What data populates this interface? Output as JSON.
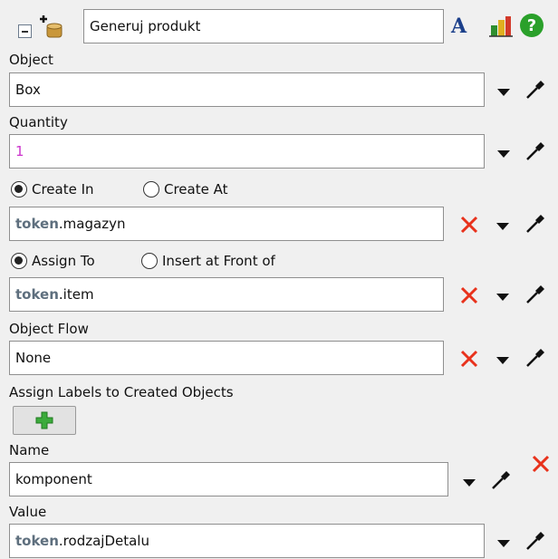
{
  "header": {
    "title": "Generuj produkt",
    "icons": [
      "collapse-icon",
      "add-object-icon",
      "font-icon",
      "color-chart-icon",
      "help-icon"
    ],
    "font_glyph": "A",
    "help_glyph": "?"
  },
  "object": {
    "label": "Object",
    "value": "Box"
  },
  "quantity": {
    "label": "Quantity",
    "value": "1"
  },
  "create": {
    "option1": "Create In",
    "option2": "Create At",
    "selected": "Create In",
    "token": "token",
    "suffix": ".magazyn"
  },
  "assign": {
    "option1": "Assign To",
    "option2": "Insert at Front of",
    "selected": "Assign To",
    "token": "token",
    "suffix": ".item"
  },
  "flow": {
    "label": "Object Flow",
    "value": "None"
  },
  "labels": {
    "title": "Assign Labels to Created Objects",
    "add_icon": "plus-icon"
  },
  "name": {
    "label": "Name",
    "value": "komponent"
  },
  "value": {
    "label": "Value",
    "token": "token",
    "suffix": ".rodzajDetalu"
  },
  "colors": {
    "accent_red": "#e8321c",
    "quantity_text": "#cc33cc",
    "token_text": "#5e6f7e",
    "help_green": "#2aa02a"
  }
}
